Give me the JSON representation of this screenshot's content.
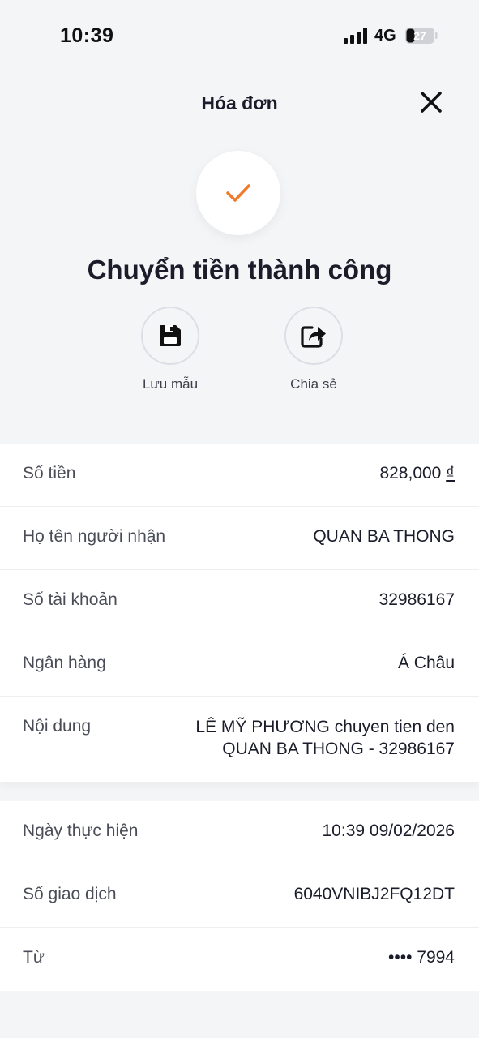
{
  "status_bar": {
    "time": "10:39",
    "network": "4G",
    "battery": "27"
  },
  "header": {
    "title": "Hóa đơn"
  },
  "success": {
    "title": "Chuyển tiền thành công"
  },
  "actions": {
    "save_label": "Lưu mẫu",
    "share_label": "Chia sẻ"
  },
  "details": {
    "amount_label": "Số tiền",
    "amount_value": "828,000",
    "currency": "₫",
    "recipient_label": "Họ tên người nhận",
    "recipient_value": "QUAN BA THONG",
    "account_label": "Số tài khoản",
    "account_value": "32986167",
    "bank_label": "Ngân hàng",
    "bank_value": "Á Châu",
    "content_label": "Nội dung",
    "content_line1": "LÊ MỸ PHƯƠNG chuyen tien den",
    "content_line2": "QUAN BA THONG - 32986167"
  },
  "transaction": {
    "date_label": "Ngày thực hiện",
    "date_value": "10:39 09/02/2026",
    "id_label": "Số giao dịch",
    "id_value": "6040VNIBJ2FQ12DT",
    "from_label": "Từ",
    "from_value": "•••• 7994"
  },
  "colors": {
    "accent": "#f07a2a",
    "text": "#1a1c2a",
    "background": "#f4f5f7"
  }
}
